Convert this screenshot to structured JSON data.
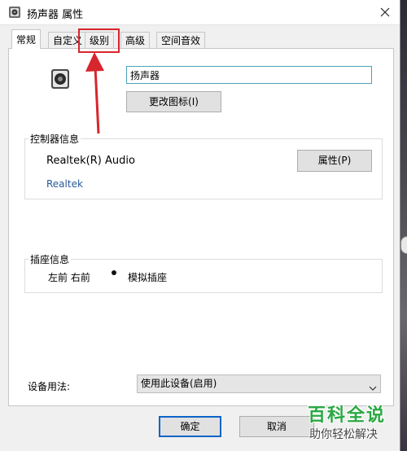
{
  "window": {
    "title": "扬声器 属性",
    "close_icon": "close-icon"
  },
  "tabs": [
    {
      "label": "常规",
      "active": true
    },
    {
      "label": "自定义",
      "active": false
    },
    {
      "label": "级别",
      "active": false,
      "highlighted": true
    },
    {
      "label": "高级",
      "active": false
    },
    {
      "label": "空间音效",
      "active": false
    }
  ],
  "device": {
    "icon": "speaker-icon",
    "name_value": "扬声器",
    "change_icon_button": "更改图标(I)"
  },
  "controller": {
    "title": "控制器信息",
    "name": "Realtek(R) Audio",
    "properties_button": "属性(P)",
    "vendor_link": "Realtek"
  },
  "jack": {
    "title": "插座信息",
    "channels": "左前 右前",
    "type": "模拟插座"
  },
  "usage": {
    "label": "设备用法:",
    "selected": "使用此设备(启用)"
  },
  "footer": {
    "ok": "确定",
    "cancel": "取消"
  },
  "annotation": {
    "highlight_color": "#d7262d"
  },
  "watermark": {
    "brand": "百科全说",
    "tagline": "助你轻松解决",
    "color": "#2aa843"
  }
}
